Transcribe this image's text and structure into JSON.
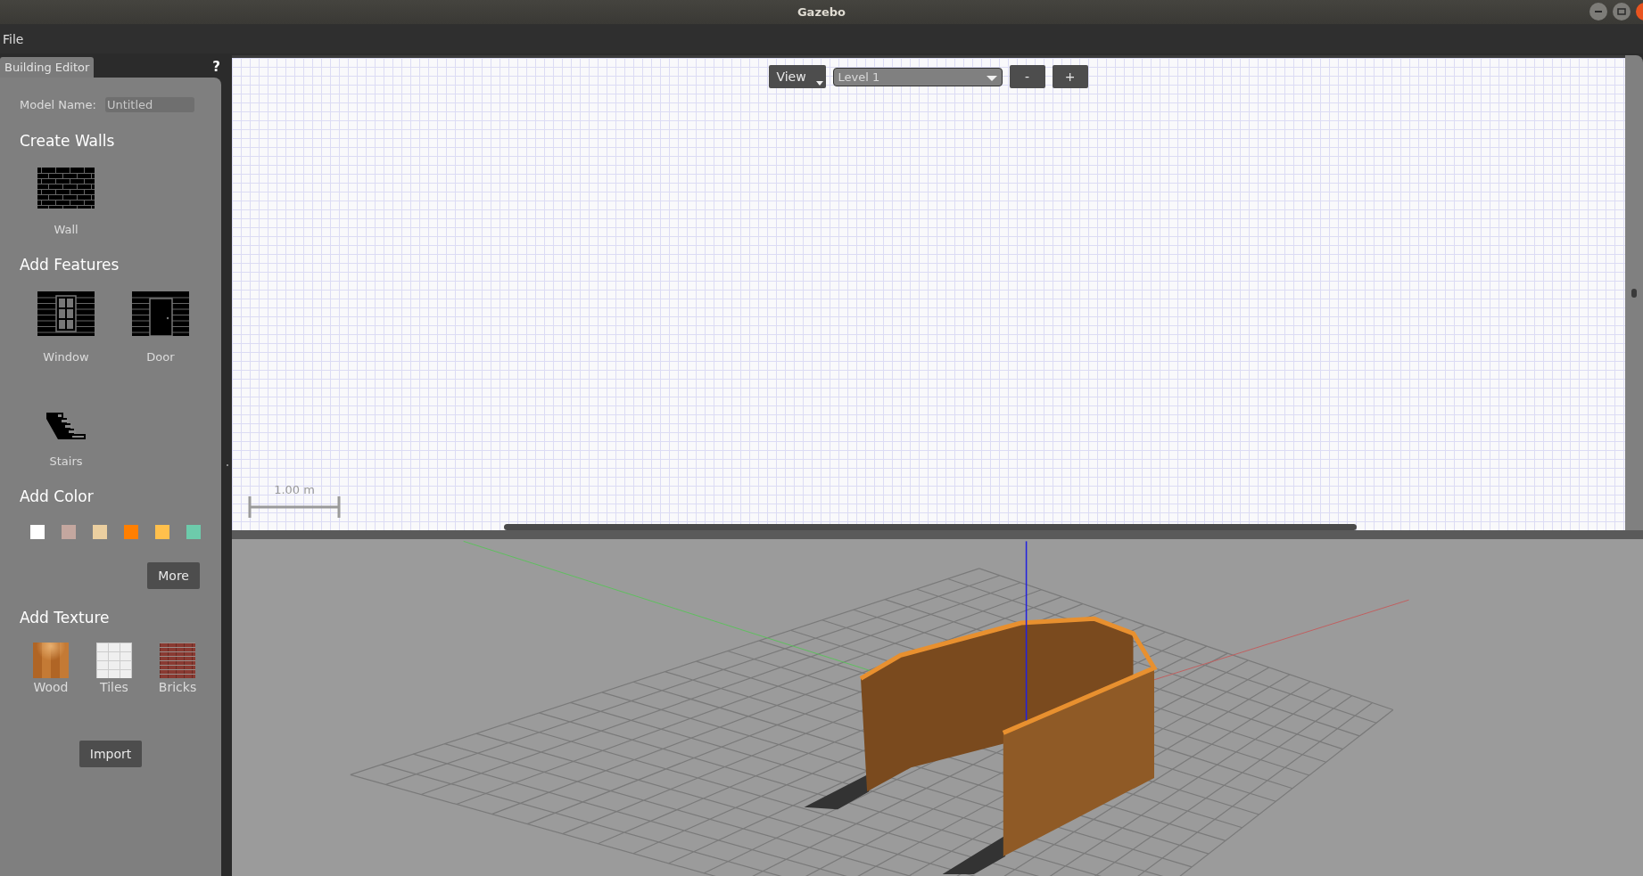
{
  "window": {
    "title": "Gazebo"
  },
  "menu": [
    "File"
  ],
  "tabs": [
    {
      "label": "Building Editor",
      "selected": true
    }
  ],
  "help": "?",
  "model_name": {
    "label": "Model Name:",
    "value": "Untitled"
  },
  "create_walls": {
    "title": "Create Walls",
    "tools": [
      {
        "label": "Wall",
        "kind": "wall"
      }
    ]
  },
  "add_features": {
    "title": "Add Features",
    "tools": [
      {
        "label": "Window",
        "kind": "window"
      },
      {
        "label": "Door",
        "kind": "door"
      },
      {
        "label": "Stairs",
        "kind": "stairs"
      }
    ]
  },
  "add_color": {
    "title": "Add Color",
    "swatches": [
      {
        "color": "#ffffff"
      },
      {
        "color": "#c4a79f"
      },
      {
        "color": "#ebcfa0"
      },
      {
        "color": "#ff7f00"
      },
      {
        "color": "#ffc04c"
      },
      {
        "color": "#6dcbab"
      }
    ],
    "more_button": "More"
  },
  "add_texture": {
    "title": "Add Texture",
    "textures": [
      {
        "label": "Wood",
        "kind": "wood"
      },
      {
        "label": "Tiles",
        "kind": "tiles"
      },
      {
        "label": "Bricks",
        "kind": "bricks"
      }
    ]
  },
  "import_button": "Import",
  "toolbar": {
    "view_button": "View",
    "level_select": "Level 1",
    "zoom_out": "-",
    "zoom_in": "+"
  },
  "scale": {
    "label": "1.00 m"
  }
}
